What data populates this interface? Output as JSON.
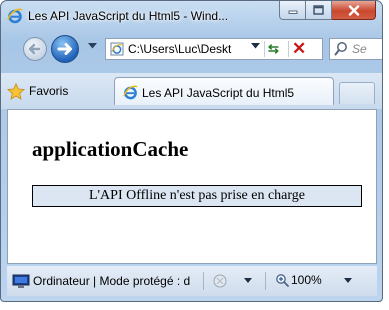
{
  "window": {
    "title": "Les API JavaScript du Html5 - Wind..."
  },
  "address_bar": {
    "url": "C:\\Users\\Luc\\Deskt"
  },
  "search": {
    "placeholder": "Se"
  },
  "favorites": {
    "label": "Favoris"
  },
  "tabs": [
    {
      "label": "Les API JavaScript du Html5"
    }
  ],
  "page": {
    "heading": "applicationCache",
    "notice": "L'API Offline n'est pas prise en charge"
  },
  "status_bar": {
    "text": "Ordinateur | Mode protégé : d",
    "zoom": "100%"
  },
  "icons": {
    "browser": "ie-icon",
    "back": "back-arrow-icon",
    "forward": "forward-arrow-icon",
    "refresh": "refresh-icon",
    "stop": "stop-icon",
    "search": "search-icon",
    "favorites": "star-icon",
    "computer": "computer-icon",
    "security": "security-settings-icon",
    "zoom": "zoom-icon"
  },
  "colors": {
    "notice_background": "#dce6f2",
    "close_button": "#c9482f",
    "forward_button": "#1f62b8"
  }
}
